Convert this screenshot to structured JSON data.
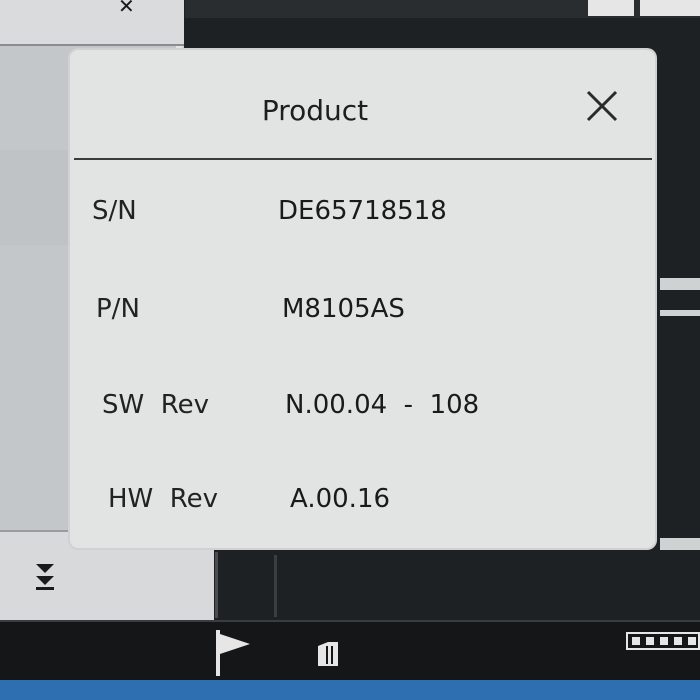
{
  "dialog": {
    "title": "Product",
    "rows": [
      {
        "label": "S/N",
        "value": "DE65718518"
      },
      {
        "label": "P/N",
        "value": "M8105AS"
      },
      {
        "label": "SW  Rev",
        "value": "N.00.04  -  108"
      },
      {
        "label": "HW  Rev",
        "value": "A.00.16"
      }
    ]
  },
  "icons": {
    "close": "close-icon",
    "collapse": "double-chevron-down-icon",
    "flag": "flag-icon",
    "marker": "marker-icon",
    "ruler": "ruler-icon"
  },
  "colors": {
    "dialog_bg": "#e2e3e3",
    "screen_bg": "#1e2123",
    "accent_blue": "#2d6fb0"
  }
}
